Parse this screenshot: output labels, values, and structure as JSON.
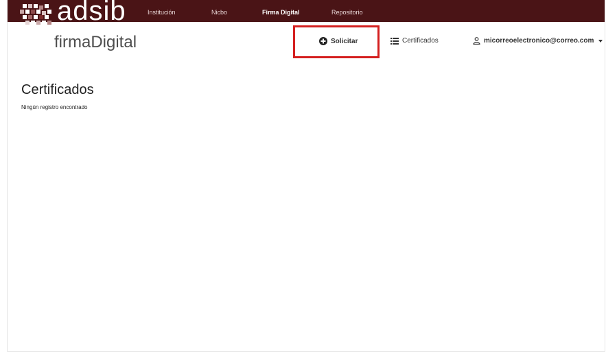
{
  "brand": {
    "logo_text": "adsib",
    "subtitle": "firmaDigital"
  },
  "top_nav": [
    {
      "label": "Institución",
      "active": false
    },
    {
      "label": "Nicbo",
      "active": false
    },
    {
      "label": "Firma Digital",
      "active": true
    },
    {
      "label": "Repositorio",
      "active": false
    }
  ],
  "sub_nav": {
    "request_label": "Solicitar",
    "certificates_label": "Certificados",
    "user_email": "micorreoelectronico@correo.com"
  },
  "main": {
    "title": "Certificados",
    "empty_message": "Ningún registro encontrado"
  },
  "icons": {
    "request": "plus-circle-icon",
    "certificates": "list-icon",
    "user": "user-icon",
    "dropdown": "caret-down-icon"
  },
  "colors": {
    "topbar": "#4a1416",
    "highlight": "#d41f1f"
  }
}
